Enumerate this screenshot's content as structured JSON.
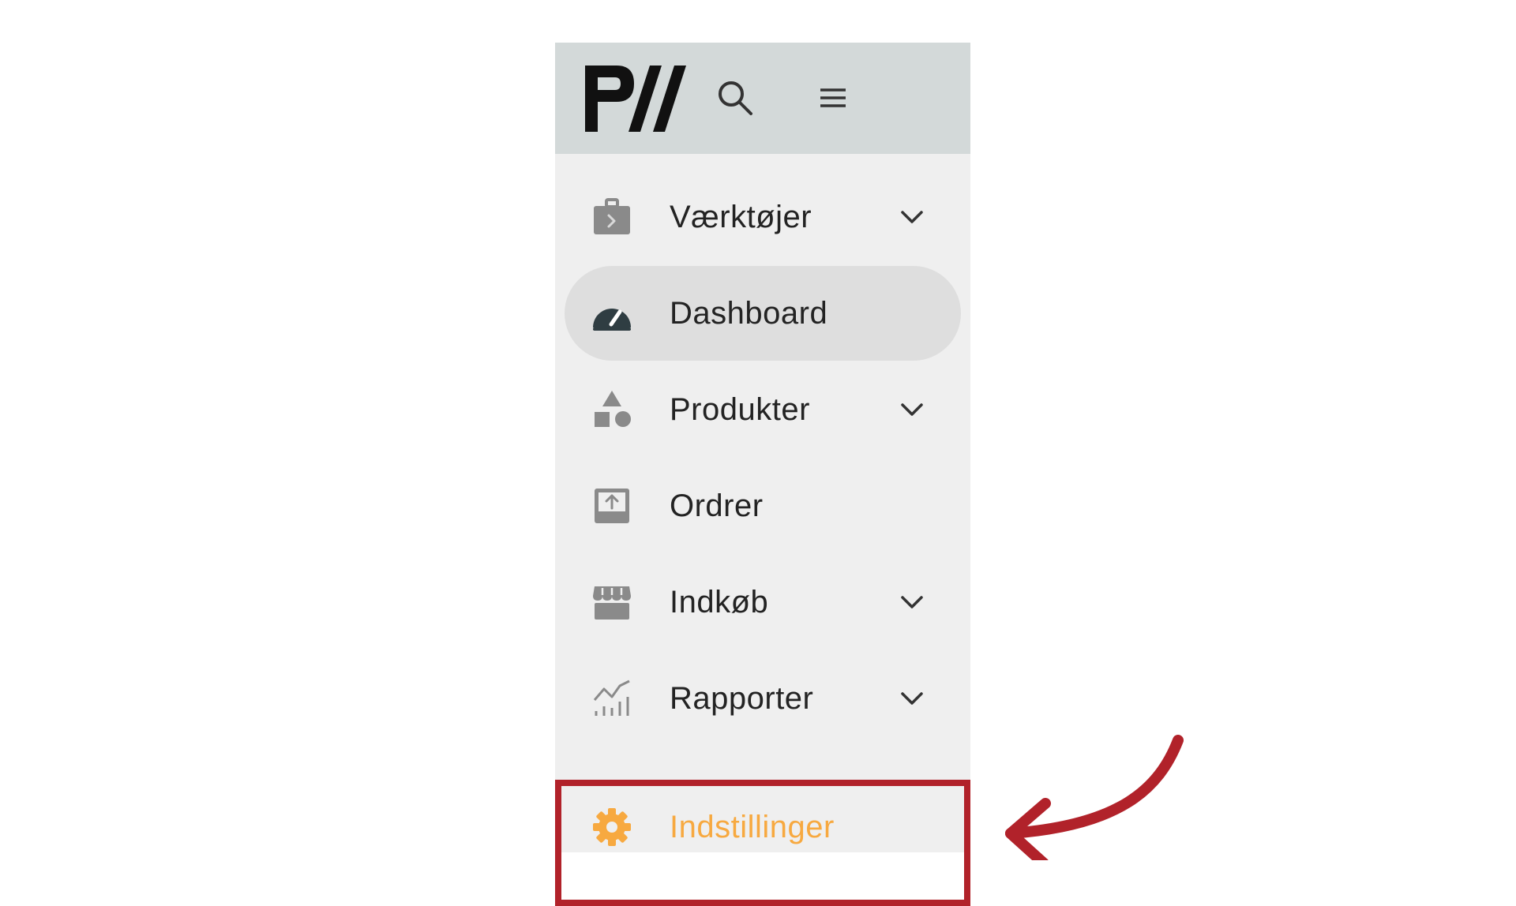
{
  "sidebar": {
    "logo": {
      "icon": "pw-logo"
    },
    "search": {
      "icon": "search-icon"
    },
    "menu": {
      "icon": "hamburger-menu-icon"
    },
    "items": [
      {
        "label": "Værktøjer",
        "icon": "toolbox-icon",
        "expandable": true,
        "active": false
      },
      {
        "label": "Dashboard",
        "icon": "speedometer-icon",
        "expandable": false,
        "active": true
      },
      {
        "label": "Produkter",
        "icon": "shapes-icon",
        "expandable": true,
        "active": false
      },
      {
        "label": "Ordrer",
        "icon": "inbox-upload-icon",
        "expandable": false,
        "active": false
      },
      {
        "label": "Indkøb",
        "icon": "storefront-icon",
        "expandable": true,
        "active": false
      },
      {
        "label": "Rapporter",
        "icon": "chart-icon",
        "expandable": true,
        "active": false
      }
    ],
    "settings": {
      "label": "Indstillinger",
      "icon": "gear-icon"
    }
  },
  "colors": {
    "topbar_bg": "#d3d9d9",
    "sidebar_bg": "#efefef",
    "active_bg": "#dedede",
    "icon_gray": "#8a8a8a",
    "text": "#232323",
    "settings_accent": "#f7a940",
    "annotation_red": "#b1222a"
  }
}
